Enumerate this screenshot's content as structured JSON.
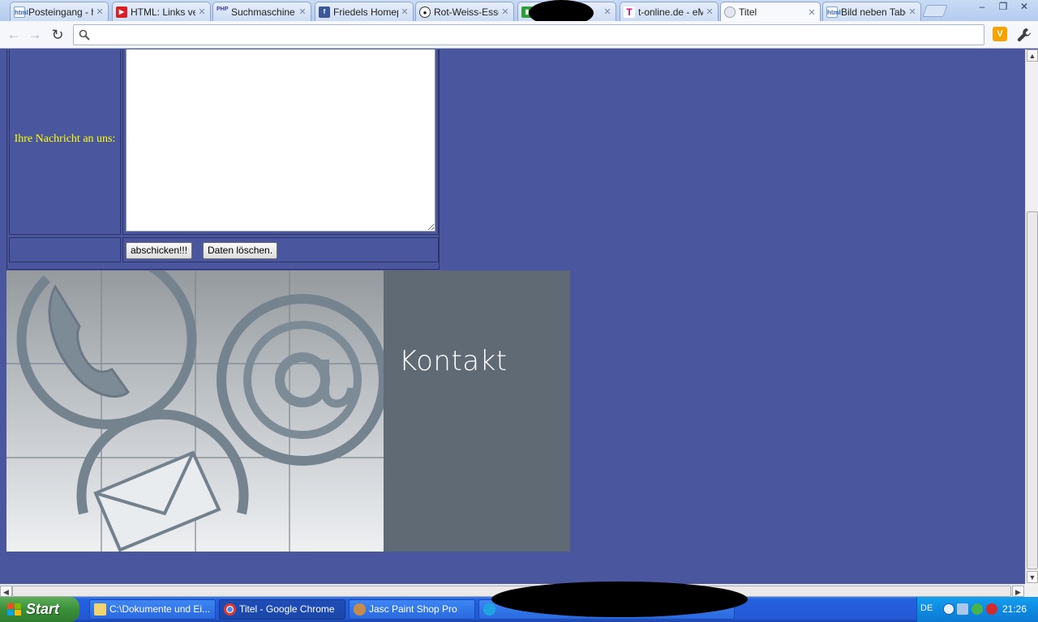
{
  "browser": {
    "tabs": [
      {
        "title": "Posteingang - h",
        "icon": "html-icon"
      },
      {
        "title": "HTML: Links ver",
        "icon": "youtube-icon"
      },
      {
        "title": "Suchmaschine a",
        "icon": "php-icon"
      },
      {
        "title": "Friedels Homepa",
        "icon": "facebook-icon"
      },
      {
        "title": "Rot-Weiss-Esse",
        "icon": "football-icon"
      },
      {
        "title": "",
        "icon": "chart-icon"
      },
      {
        "title": "t-online.de - eM",
        "icon": "telekom-icon"
      },
      {
        "title": "Titel",
        "icon": "globe-icon"
      },
      {
        "title": "Bild neben Tabe",
        "icon": "html-icon"
      }
    ],
    "active_tab_index": 7,
    "window_controls": {
      "minimize": "–",
      "maximize": "❐",
      "close": "✕"
    },
    "address_bar": {
      "value": "",
      "placeholder": ""
    }
  },
  "page": {
    "form": {
      "message_label": "Ihre Nachricht an uns:",
      "message_value": "",
      "submit_label": "abschicken!!!",
      "reset_label": "Daten löschen."
    },
    "contact_banner": {
      "title": "Kontakt",
      "accent_color": "#5f6a74"
    },
    "background_color": "#4a569d",
    "label_color": "#ffff00"
  },
  "taskbar": {
    "start_label": "Start",
    "tasks": [
      {
        "label": "C:\\Dokumente und Ei...",
        "icon": "folder-icon"
      },
      {
        "label": "Titel - Google Chrome",
        "icon": "chrome-icon"
      },
      {
        "label": "Jasc Paint Shop Pro",
        "icon": "paint-shop-icon"
      },
      {
        "label": "",
        "icon": "skype-icon"
      }
    ],
    "language": "DE",
    "clock": "21:26"
  }
}
